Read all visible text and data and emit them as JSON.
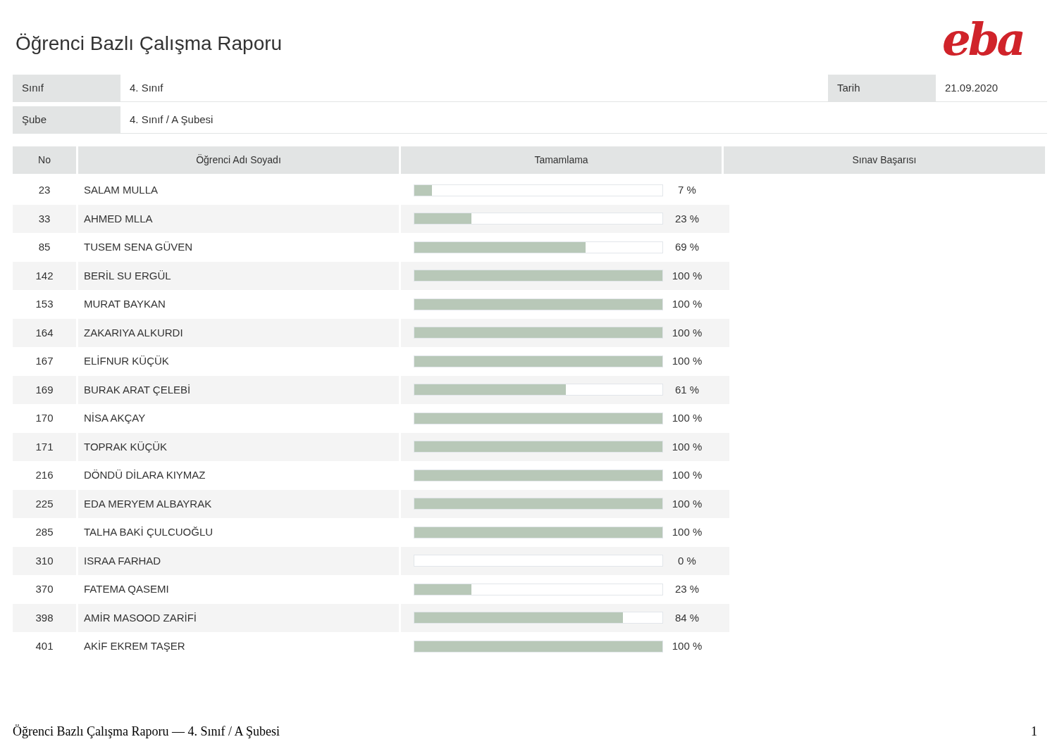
{
  "title": "Öğrenci Bazlı Çalışma Raporu",
  "logo": "eba",
  "info": [
    {
      "label": "Sınıf",
      "value": "4. Sınıf",
      "side_label": "Tarih",
      "side_value": "21.09.2020"
    },
    {
      "label": "Şube",
      "value": "4. Sınıf / A Şubesi"
    }
  ],
  "table": {
    "columns": [
      "No",
      "Öğrenci Adı Soyadı",
      "Tamamlama",
      "Sınav Başarısı"
    ],
    "rows": [
      {
        "no": "23",
        "name": "SALAM MULLA",
        "level": 0.07,
        "reading": "7 %"
      },
      {
        "no": "33",
        "name": "AHMED MLLA",
        "level": 0.23,
        "reading": "23 %"
      },
      {
        "no": "85",
        "name": "TUSEM SENA GÜVEN",
        "level": 0.69,
        "reading": "69 %"
      },
      {
        "no": "142",
        "name": "BERİL SU ERGÜL",
        "level": 1,
        "reading": "100 %"
      },
      {
        "no": "153",
        "name": "MURAT BAYKAN",
        "level": 1,
        "reading": "100 %"
      },
      {
        "no": "164",
        "name": "ZAKARIYA ALKURDI",
        "level": 1,
        "reading": "100 %"
      },
      {
        "no": "167",
        "name": "ELİFNUR KÜÇÜK",
        "level": 1,
        "reading": "100 %"
      },
      {
        "no": "169",
        "name": "BURAK ARAT ÇELEBİ",
        "level": 0.61,
        "reading": "61 %"
      },
      {
        "no": "170",
        "name": "NİSA AKÇAY",
        "level": 1,
        "reading": "100 %"
      },
      {
        "no": "171",
        "name": "TOPRAK KÜÇÜK",
        "level": 1,
        "reading": "100 %"
      },
      {
        "no": "216",
        "name": "DÖNDÜ DİLARA KIYMAZ",
        "level": 1,
        "reading": "100 %"
      },
      {
        "no": "225",
        "name": "EDA MERYEM ALBAYRAK",
        "level": 1,
        "reading": "100 %"
      },
      {
        "no": "285",
        "name": "TALHA BAKİ ÇULCUOĞLU",
        "level": 1,
        "reading": "100 %"
      },
      {
        "no": "310",
        "name": "ISRAA FARHAD",
        "level": 0,
        "reading": "0 %"
      },
      {
        "no": "370",
        "name": "FATEMA QASEMI",
        "level": 0.23,
        "reading": "23 %"
      },
      {
        "no": "398",
        "name": "AMİR MASOOD ZARİFİ",
        "level": 0.84,
        "reading": "84 %"
      },
      {
        "no": "401",
        "name": "AKİF EKREM TAŞER",
        "level": 1,
        "reading": "100 %"
      }
    ]
  },
  "footer": {
    "text": "Öğrenci Bazlı Çalışma Raporu — 4. Sınıf / A Şubesi",
    "page": "1"
  }
}
